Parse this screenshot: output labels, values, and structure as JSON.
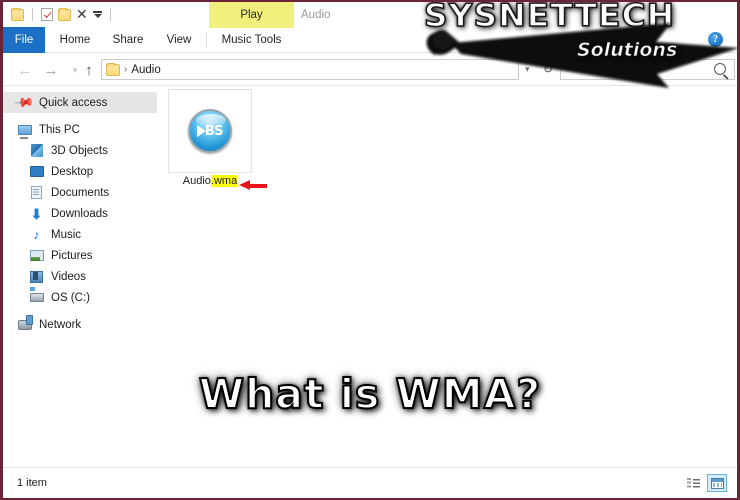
{
  "window": {
    "title": "Audio",
    "contextual_tab_group": "Play",
    "help_icon": "?"
  },
  "quick_access_toolbar": {
    "items": [
      {
        "name": "folder-icon",
        "label": ""
      },
      {
        "name": "properties-icon",
        "label": ""
      },
      {
        "name": "new-folder-icon",
        "label": ""
      },
      {
        "name": "delete-icon",
        "label": "✕"
      },
      {
        "name": "customize-dropdown-icon",
        "label": ""
      }
    ]
  },
  "ribbon": {
    "tabs": [
      {
        "id": "file",
        "label": "File",
        "selected": true
      },
      {
        "id": "home",
        "label": "Home",
        "selected": false
      },
      {
        "id": "share",
        "label": "Share",
        "selected": false
      },
      {
        "id": "view",
        "label": "View",
        "selected": false
      },
      {
        "id": "music-tools",
        "label": "Music Tools",
        "selected": false
      }
    ],
    "accent_color": "#f1f07c",
    "file_tab_color": "#1b6fc4"
  },
  "address_bar": {
    "back_label": "←",
    "forward_label": "→",
    "recent_label": "▾",
    "up_label": "↑",
    "breadcrumb_separator": "›",
    "breadcrumb": "Audio",
    "history_chevron": "▾",
    "refresh_label": "↻",
    "search_placeholder": ""
  },
  "sidebar": {
    "items": [
      {
        "label": "Quick access",
        "icon": "pin-icon",
        "indent": 0,
        "selected": true,
        "gap": false
      },
      {
        "label": "This PC",
        "icon": "this-pc-icon",
        "indent": 0,
        "selected": false,
        "gap": true
      },
      {
        "label": "3D Objects",
        "icon": "3d-objects-icon",
        "indent": 1,
        "selected": false,
        "gap": false
      },
      {
        "label": "Desktop",
        "icon": "desktop-icon",
        "indent": 1,
        "selected": false,
        "gap": false
      },
      {
        "label": "Documents",
        "icon": "documents-icon",
        "indent": 1,
        "selected": false,
        "gap": false
      },
      {
        "label": "Downloads",
        "icon": "downloads-icon",
        "indent": 1,
        "selected": false,
        "gap": false
      },
      {
        "label": "Music",
        "icon": "music-icon",
        "indent": 1,
        "selected": false,
        "gap": false
      },
      {
        "label": "Pictures",
        "icon": "pictures-icon",
        "indent": 1,
        "selected": false,
        "gap": false
      },
      {
        "label": "Videos",
        "icon": "videos-icon",
        "indent": 1,
        "selected": false,
        "gap": false
      },
      {
        "label": "OS (C:)",
        "icon": "drive-icon",
        "indent": 1,
        "selected": false,
        "gap": false
      },
      {
        "label": "Network",
        "icon": "network-icon",
        "indent": 0,
        "selected": false,
        "gap": true
      }
    ]
  },
  "file_list": {
    "items": [
      {
        "name_base": "Audio",
        "name_ext": ".wma",
        "full_name": "Audio.wma",
        "icon": "bs-player-icon",
        "icon_glyph": "BS",
        "highlight_color": "#ffff00"
      }
    ]
  },
  "annotations": {
    "arrow_color": "#e8141c",
    "arrow_points_to": "Audio.wma"
  },
  "status_bar": {
    "item_count_label": "1 item",
    "views": [
      {
        "name": "details-view-button",
        "active": false
      },
      {
        "name": "large-icons-view-button",
        "active": true
      }
    ]
  },
  "watermarks": {
    "brand_primary": "SYSNETTECH",
    "brand_secondary": "Solutions",
    "headline": "What is WMA?"
  }
}
